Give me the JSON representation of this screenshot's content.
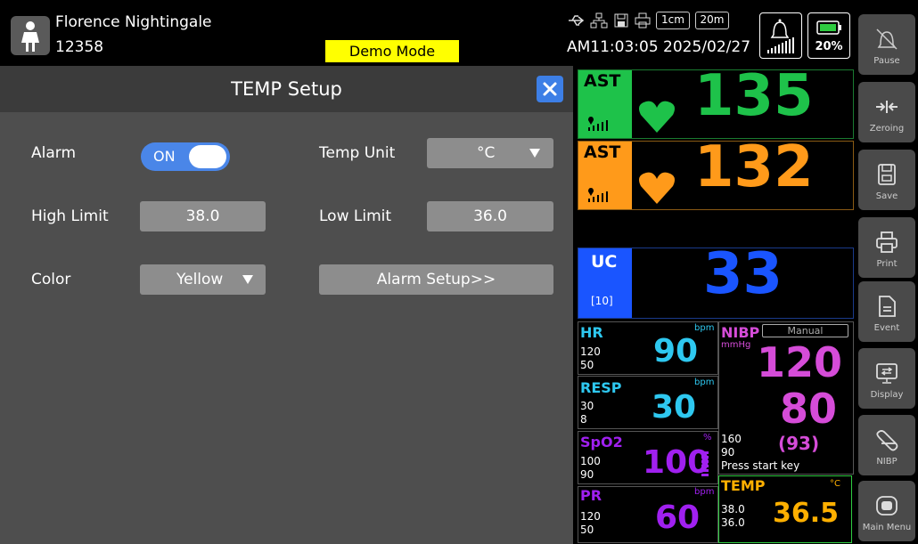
{
  "patient": {
    "name": "Florence Nightingale",
    "id": "12358"
  },
  "mode_banner": "Demo Mode",
  "status": {
    "speed1": "1cm",
    "speed2": "20m",
    "datetime": "AM11:03:05 2025/02/27",
    "battery": "20%"
  },
  "dialog": {
    "title": "TEMP Setup",
    "alarm": {
      "label": "Alarm",
      "value": "ON"
    },
    "temp_unit": {
      "label": "Temp Unit",
      "value": "°C"
    },
    "high_limit": {
      "label": "High Limit",
      "value": "38.0"
    },
    "low_limit": {
      "label": "Low Limit",
      "value": "36.0"
    },
    "color": {
      "label": "Color",
      "value": "Yellow"
    },
    "alarm_setup": "Alarm Setup>>"
  },
  "fhr1": {
    "label": "AST",
    "value": "135",
    "color": "#1ec24a"
  },
  "fhr2": {
    "label": "AST",
    "value": "132",
    "color": "#ff9a1a"
  },
  "uc": {
    "label": "UC",
    "sub": "[10]",
    "value": "33",
    "color": "#1a55ff"
  },
  "hr": {
    "label": "HR",
    "unit": "bpm",
    "upper": "120",
    "lower": "50",
    "value": "90"
  },
  "resp": {
    "label": "RESP",
    "unit": "bpm",
    "upper": "30",
    "lower": "8",
    "value": "30"
  },
  "spo2": {
    "label": "SpO2",
    "unit": "%",
    "upper": "100",
    "lower": "90",
    "value": "100"
  },
  "pr": {
    "label": "PR",
    "unit": "bpm",
    "upper": "120",
    "lower": "50",
    "value": "60"
  },
  "nibp": {
    "label": "NIBP",
    "mode": "Manual",
    "unit": "mmHg",
    "systolic": "120",
    "diastolic": "80",
    "mean": "(93)",
    "upper": "160",
    "lower": "90",
    "hint": "Press start key"
  },
  "temp": {
    "label": "TEMP",
    "unit": "°C",
    "upper": "38.0",
    "lower": "36.0",
    "value": "36.5"
  },
  "sidebar": [
    "Pause",
    "Zeroing",
    "Save",
    "Print",
    "Event",
    "Display",
    "NIBP",
    "Main Menu"
  ]
}
